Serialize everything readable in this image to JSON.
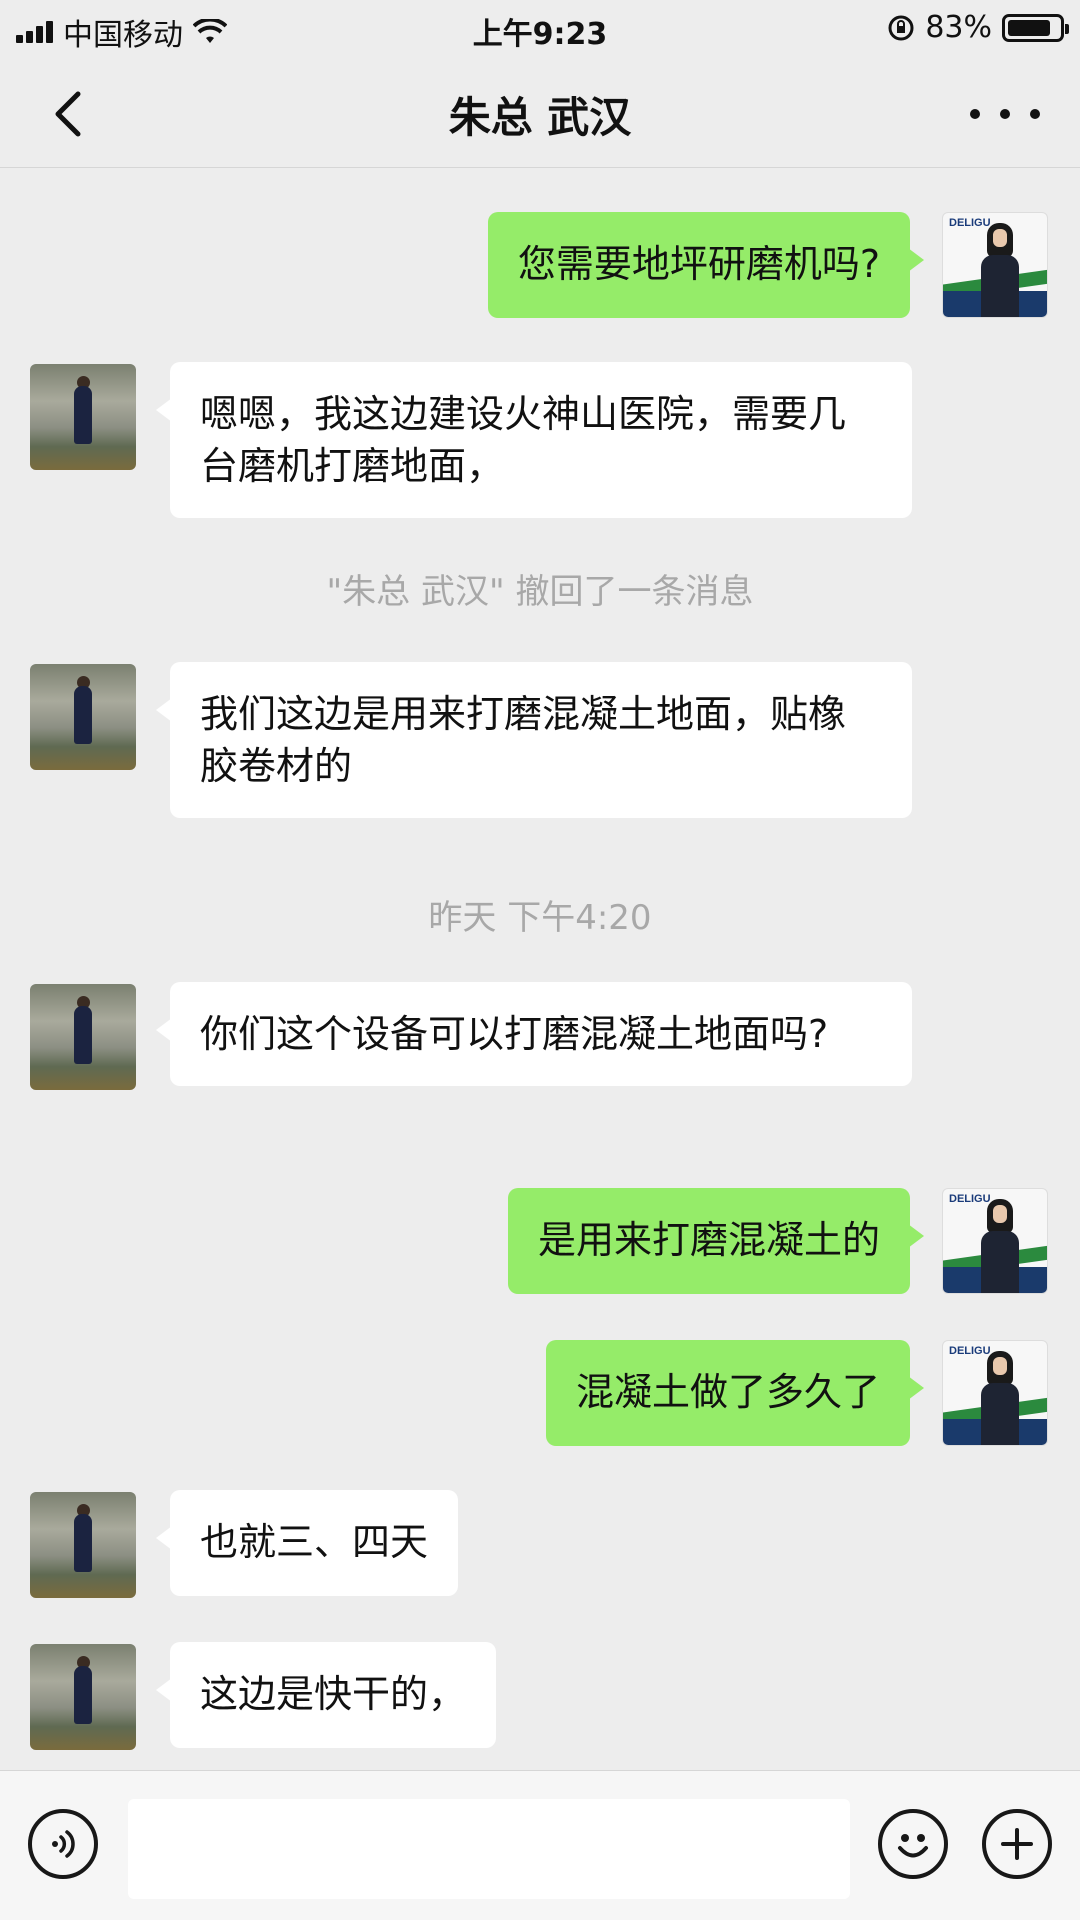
{
  "status_bar": {
    "carrier": "中国移动",
    "time": "上午9:23",
    "battery": "83%",
    "battery_level": 0.83
  },
  "nav": {
    "title": "朱总 武汉",
    "back_icon": "chevron-left-icon",
    "more_icon": "more-dots-icon"
  },
  "messages": [
    {
      "from": "self",
      "text": "您需要地坪研磨机吗?"
    },
    {
      "from": "other",
      "text": "嗯嗯，我这边建设火神山医院，需要几台磨机打磨地面，"
    },
    {
      "system": "\"朱总 武汉\" 撤回了一条消息"
    },
    {
      "from": "other",
      "text": "我们这边是用来打磨混凝土地面，贴橡胶卷材的"
    },
    {
      "system": "昨天 下午4:20"
    },
    {
      "from": "other",
      "text": "你们这个设备可以打磨混凝土地面吗?"
    },
    {
      "from": "self",
      "text": "是用来打磨混凝土的"
    },
    {
      "from": "self",
      "text": "混凝土做了多久了"
    },
    {
      "from": "other",
      "text": "也就三、四天"
    },
    {
      "from": "other",
      "text": "这边是快干的，"
    }
  ],
  "self_avatar_brand": "DELIGU",
  "input": {
    "value": "",
    "voice_icon": "voice-icon",
    "emoji_icon": "emoji-icon",
    "plus_icon": "plus-icon"
  },
  "colors": {
    "self_bubble": "#95ec69",
    "other_bubble": "#ffffff",
    "background": "#ededed"
  }
}
